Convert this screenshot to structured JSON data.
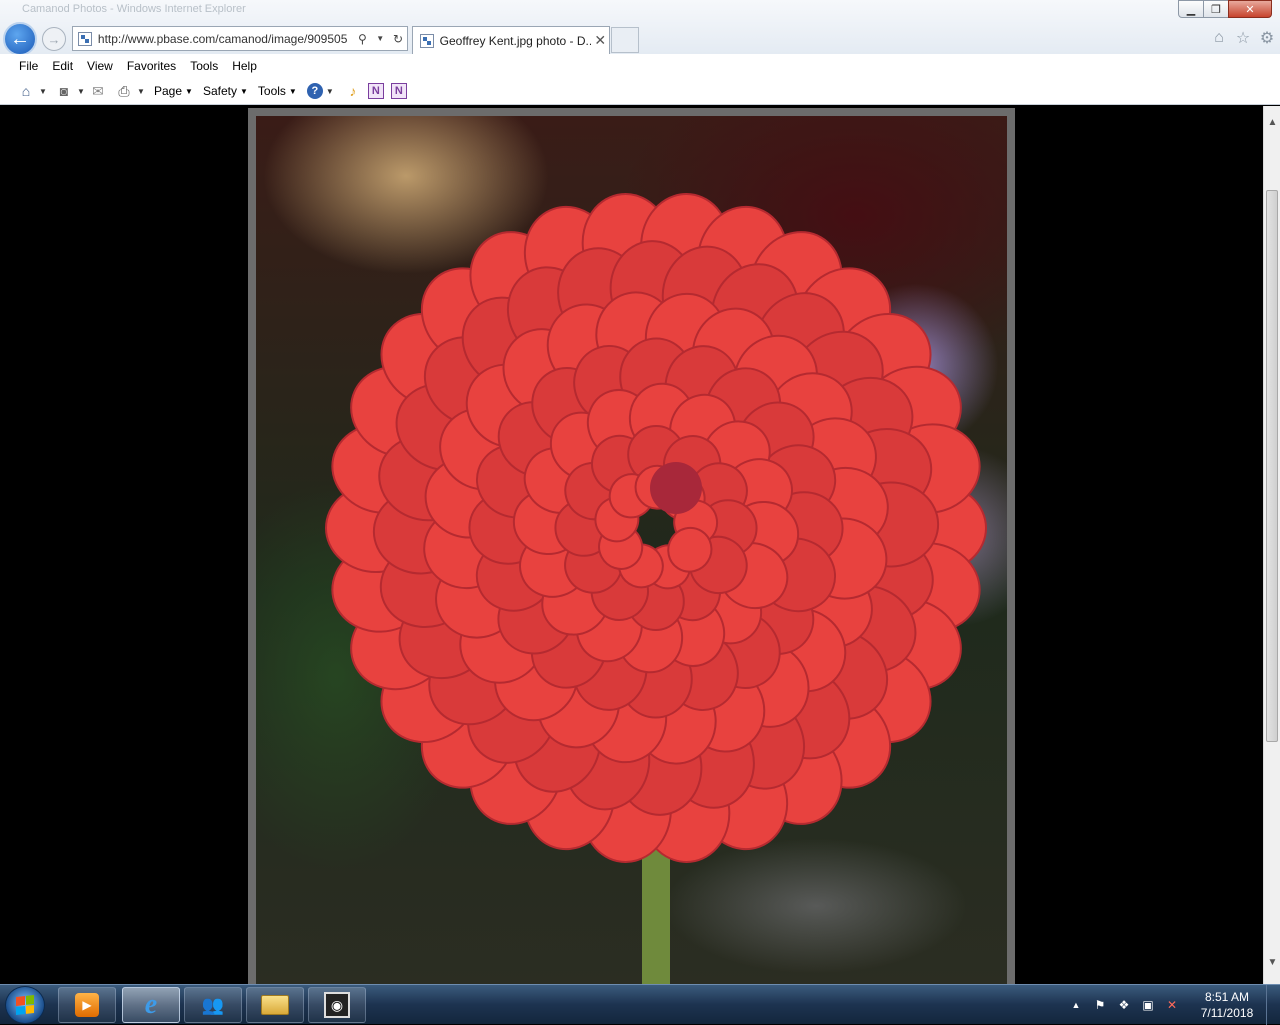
{
  "window": {
    "caption": "Camanod Photos - Windows Internet Explorer",
    "controls": {
      "minimize": "▁",
      "restore": "❐",
      "close": "✕"
    }
  },
  "nav": {
    "back_icon": "back-arrow-icon",
    "forward_icon": "forward-arrow-icon",
    "address": "http://www.pbase.com/camanod/image/909505",
    "tab_title": "Geoffrey Kent.jpg photo - D...",
    "tab_close": "✕"
  },
  "menu": [
    "File",
    "Edit",
    "View",
    "Favorites",
    "Tools",
    "Help"
  ],
  "command_bar": {
    "page": "Page",
    "safety": "Safety",
    "tools": "Tools",
    "help": "?",
    "onenote": "N",
    "onenote2": "N"
  },
  "photo": {
    "subject": "red dahlia flower",
    "petal_color": "#e8423f",
    "center_color": "#a8283a",
    "stem_color": "#6f8a3c"
  },
  "taskbar": {
    "clock_time": "8:51 AM",
    "clock_date": "7/11/2018",
    "ie_glyph": "e",
    "apps": [
      "media-player-icon",
      "internet-explorer-icon",
      "contacts-icon",
      "file-explorer-icon",
      "image-viewer-icon"
    ]
  },
  "colors": {
    "accent": "#1c5bb8",
    "taskbar": "#1d3350",
    "content_bg": "#000000",
    "frame": "#6c6c6c"
  }
}
